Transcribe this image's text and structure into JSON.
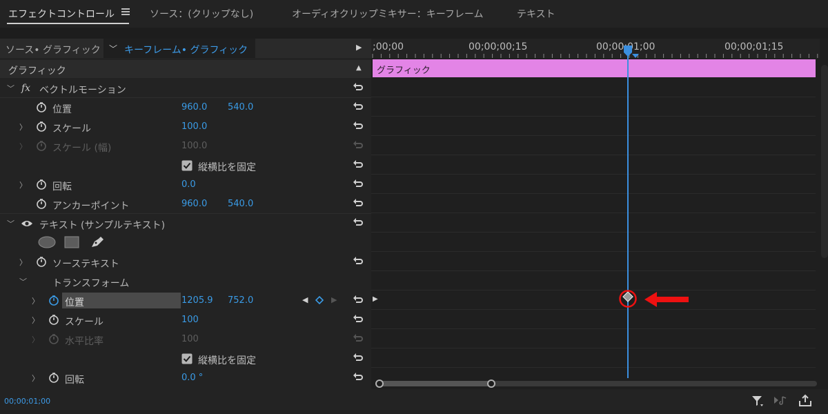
{
  "tabs": {
    "effect_controls": "エフェクトコントロール",
    "source": "ソース：(クリップなし)",
    "audio_mixer": "オーディオクリップミキサー：キーフレーム",
    "text": "テキスト"
  },
  "subheader": {
    "source_label": "ソース• グラフィック",
    "keyframe_label": "キーフレーム• グラフィック"
  },
  "section_title": "グラフィック",
  "vector_motion": {
    "title": "ベクトルモーション",
    "position": {
      "label": "位置",
      "x": "960.0",
      "y": "540.0"
    },
    "scale": {
      "label": "スケール",
      "value": "100.0"
    },
    "scale_width": {
      "label": "スケール (幅)",
      "value": "100.0"
    },
    "uniform_scale": "縦横比を固定",
    "rotation": {
      "label": "回転",
      "value": "0.0"
    },
    "anchor": {
      "label": "アンカーポイント",
      "x": "960.0",
      "y": "540.0"
    }
  },
  "text_layer": {
    "title": "テキスト (サンプルテキスト)",
    "source_text": "ソーステキスト",
    "transform": "トランスフォーム",
    "position": {
      "label": "位置",
      "x": "1205.9",
      "y": "752.0"
    },
    "scale": {
      "label": "スケール",
      "value": "100"
    },
    "horizontal_ratio": {
      "label": "水平比率",
      "value": "100"
    },
    "uniform_scale": "縦横比を固定",
    "rotation": {
      "label": "回転",
      "value": "0.0 °"
    }
  },
  "timeline": {
    "timecodes": [
      ";00;00",
      "00;00;00;15",
      "00;00;01;00",
      "00;00;01;15"
    ],
    "clip_label": "グラフィック"
  },
  "current_timecode": "00;00;01;00",
  "colors": {
    "accent_blue": "#3a9be6",
    "clip_pink": "#e384e6",
    "annotation_red": "#ee1111"
  }
}
